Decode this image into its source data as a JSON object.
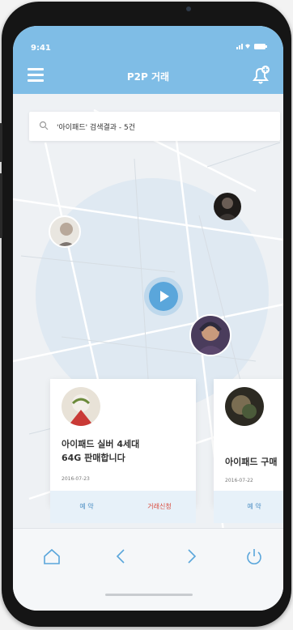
{
  "status": {
    "time": "9:41",
    "indicators": "signal wifi battery"
  },
  "appbar": {
    "title": "P2P 거래",
    "menu_icon": "hamburger-menu-icon",
    "bell_icon": "bell-plus-icon"
  },
  "search": {
    "text": "'아이패드' 검색결과 - 5건",
    "icon": "search-icon"
  },
  "map": {
    "center_icon": "play-location-icon"
  },
  "cards": [
    {
      "title_line1": "아이패드 실버 4세대",
      "title_line2": "64G 판매합니다",
      "date": "2016-07-23",
      "subscribe_label": "예 약",
      "deal_label": "거래신청"
    },
    {
      "title_line1": "아이패드 구매",
      "date": "2016-07-22",
      "subscribe_label": "예 약"
    }
  ],
  "bottom_nav": {
    "icons": [
      "home-icon",
      "back-icon",
      "forward-icon",
      "power-icon"
    ]
  },
  "colors": {
    "header": "#7fbde6",
    "accent": "#5aa6db",
    "deal": "#d94a3c",
    "action_bg": "#e7f1f9"
  }
}
